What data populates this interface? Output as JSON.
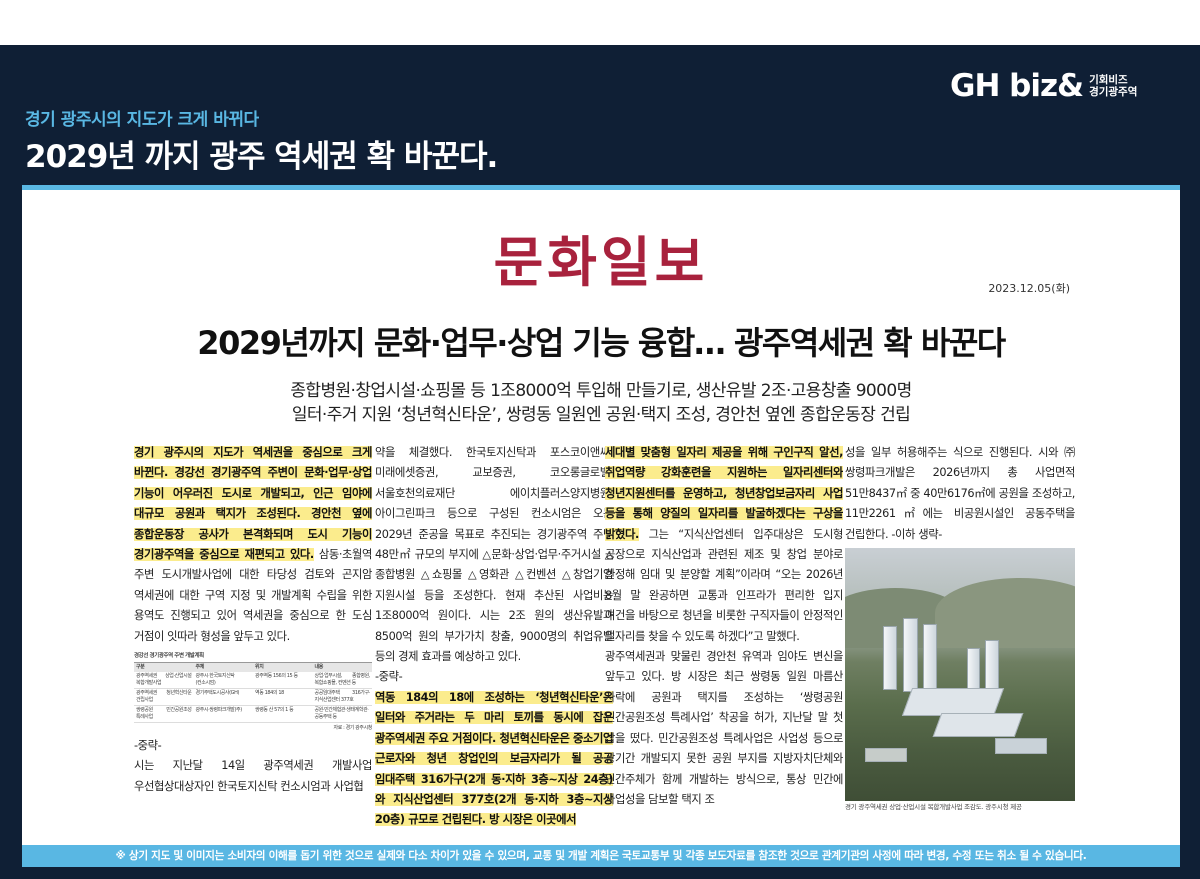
{
  "header": {
    "logo_main": "GH biz&",
    "logo_sub_line1": "기회비즈",
    "logo_sub_line2": "경기광주역",
    "subtitle": "경기 광주시의 지도가 크게 바뀌다",
    "headline": "2029년 까지 광주 역세권 확 바꾼다."
  },
  "article": {
    "masthead": "문화일보",
    "date": "2023.12.05(화)",
    "title": "2029년까지 문화·업무·상업 기능 융합… 광주역세권 확 바꾼다",
    "deck_line1": "종합병원·창업시설·쇼핑몰 등 1조8000억 투입해 만들기로, 생산유발 2조·고용창출 9000명",
    "deck_line2": "일터·주거 지원 ‘청년혁신타운’, 쌍령동 일원엔 공원·택지 조성, 경안천 옆엔 종합운동장 건립",
    "col1_hl": "경기 광주시의 지도가 역세권을 중심으로 크게 바뀐다. 경강선 경기광주역 주변이 문화·업무·상업 기능이 어우러진 도시로 개발되고, 인근 임야에 대규모 공원과 택지가 조성된다. 경안천 옆에 종합운동장 공사가 본격화되며 도시 기능이 경기광주역을 중심으로 재편되고 있다.",
    "col1_text": " 삼동·초월역 주변 도시개발사업에 대한 타당성 검토와 곤지암 역세권에 대한 구역 지정 및 개발계획 수립을 위한 용역도 진행되고 있어 역세권을 중심으로 한 도심 거점이 잇따라 형성을 앞두고 있다.",
    "table": {
      "title": "경강선 경기광주역 주변 개발계획",
      "headers": [
        "구분",
        "주체",
        "위치",
        "내용"
      ],
      "rows": [
        [
          "광주역세권 상업·산업시설 복합개발사업",
          "광주시·한국토지신탁(컨소시엄)",
          "광주역동 156의 15 등",
          "상업·업무시설, 종합병원, 복합쇼핑몰, 컨벤션 등"
        ],
        [
          "광주역세권 청년혁신타운 건립사업",
          "경기주택도시공사(GH)",
          "역동 184의 18",
          "공공임대주택 316가구·지식산업센터 377호"
        ],
        [
          "쌍령공원 민간공원조성 특례사업",
          "광주시·쌍령파크개발(주)",
          "쌍령동 산 57의 1 등",
          "공원·민간체험관·생태계학관·공동주택 등"
        ]
      ],
      "source": "자료 : 경기 광주시청"
    },
    "col1_mid": "-중략-",
    "col1_tail": "시는 지난달 14일 광주역세권 개발사업 우선협상대상자인 한국토지신탁 컨소시엄과 사업협",
    "col2_text": "약을 체결했다. 한국토지신탁과 포스코이앤씨, 미래에셋증권, 교보증권, 코오롱글로벌, 서울호천의료재단 에이치플러스양지병원, 아이그린파크 등으로 구성된 컨소시엄은 오는 2029년 준공을 목표로 추진되는 경기광주역 주변 48만㎡ 규모의 부지에 △문화·상업·업무·주거시설 △종합병원 △쇼핑몰 △영화관 △컨벤션 △창업기업 지원시설 등을 조성한다. 현재 추산된 사업비는 1조8000억 원이다. 시는 2조 원의 생산유발과 8500억 원의 부가가치 창출, 9000명의 취업유발 등의 경제 효과를 예상하고 있다.",
    "col2_mid": "-중략-",
    "col2_hl": "역동 184의 18에 조성하는 ‘청년혁신타운’은 일터와 주거라는 두 마리 토끼를 동시에 잡은 광주역세권 주요 거점이다. 청년혁신타운은 중소기업 근로자와 청년 창업인의 보금자리가 될 공공 임대주택 316가구(2개 동·지하 3층~지상 24층)와 지식산업센터 377호(2개 동·지하 3층~지상 20층) 규모로 건립된다. 방 시장은 이곳에서",
    "col3_hl": "세대별 맞춤형 일자리 제공을 위해 구인구직 알선, 취업역량 강화훈련을 지원하는 일자리센터와 청년지원센터를 운영하고, 청년창업보금자리 사업 등을 통해 양질의 일자리를 발굴하겠다는 구상을 밝혔다.",
    "col3_text": " 그는 “지식산업센터 입주대상은 도시형 공장으로 지식산업과 관련된 제조 및 창업 분야로 한정해 임대 및 분양할 계획”이라며 “오는 2026년 8월 말 완공하면 교통과 인프라가 편리한 입지 여건을 바탕으로 청년을 비롯한 구직자들이 안정적인 일자리를 찾을 수 있도록 하겠다”고 말했다.",
    "col3_text2": "광주역세권과 맞물린 경안천 유역과 임야도 변신을 앞두고 있다. 방 시장은 최근 쌍령동 일원 마름산 자락에 공원과 택지를 조성하는 ‘쌍령공원 민간공원조성 특례사업’ 착공을 허가, 지난달 말 첫 삽을 떴다. 민간공원조성 특례사업은 사업성 등으로 장기간 개발되지 못한 공원 부지를 지방자치단체와 민간주체가 함께 개발하는 방식으로, 통상 민간에 사업성을 담보할 택지 조",
    "col4_text": "성을 일부 허용해주는 식으로 진행된다. 시와 ㈜쌍령파크개발은 2026년까지 총 사업면적 51만8437㎡ 중 40만6176㎡에 공원을 조성하고, 11만2261㎡에는 비공원시설인 공동주택을 건립한다.",
    "col4_end": " -이하 생략-",
    "photo_caption": "경기 광주역세권 상업·산업시설 복합개발사업 조감도. 광주시청 제공"
  },
  "footer": {
    "disclaimer": "※ 상기 지도 및 이미지는 소비자의 이해를 돕기 위한 것으로 실제와 다소 차이가 있을 수 있으며, 교통 및 개발 계획은 국토교통부 및 각종 보도자료를 참조한 것으로 관계기관의 사정에 따라 변경, 수정 또는 취소 될 수 있습니다."
  },
  "colors": {
    "frame": "#0f1f35",
    "accent": "#59b7e3",
    "masthead": "#a8223d",
    "highlight": "#fbec8d"
  }
}
